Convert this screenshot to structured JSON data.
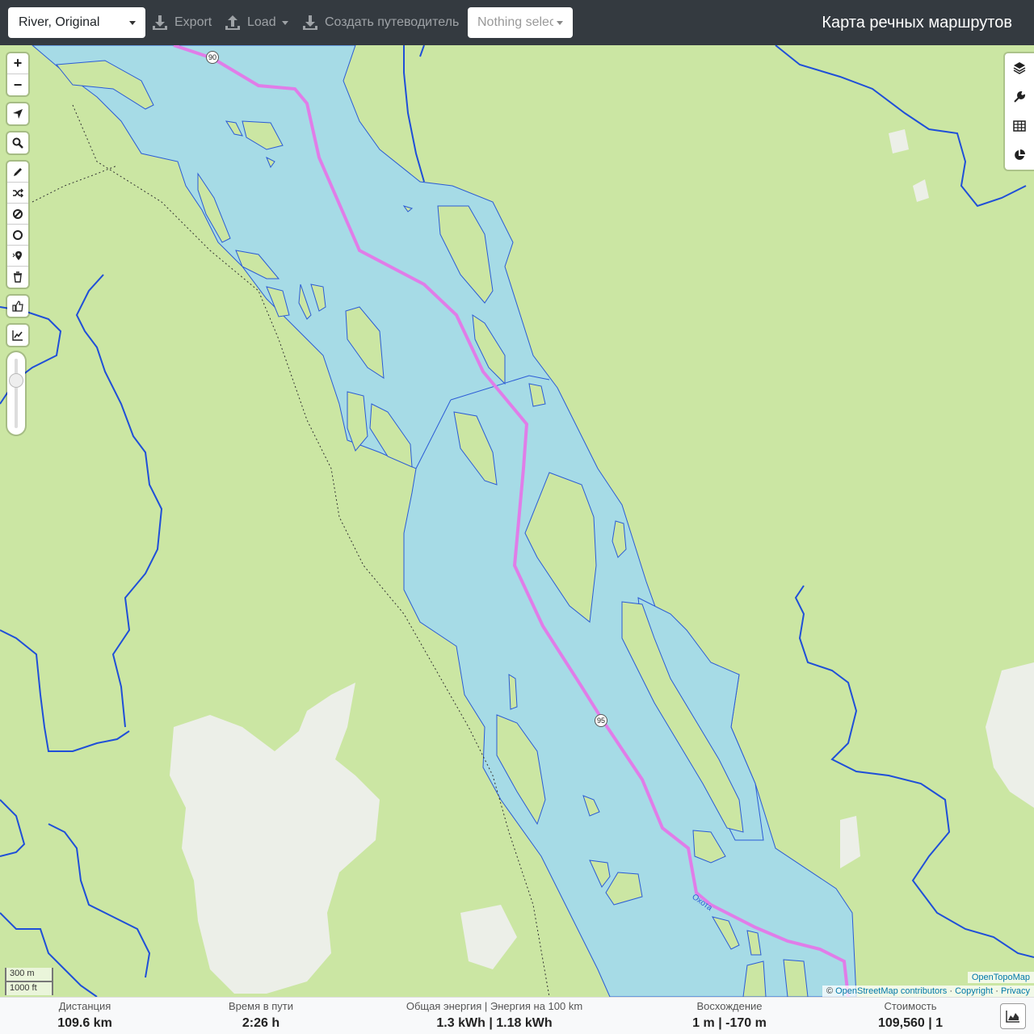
{
  "header": {
    "profile": "River, Original",
    "export_label": "Export",
    "load_label": "Load",
    "guide_label": "Создать путеводитель",
    "nothing_selected": "Nothing selected",
    "title": "Карта речных маршрутов"
  },
  "map": {
    "route_markers": [
      "90",
      "95"
    ],
    "river_label": "Охота",
    "scale": {
      "metric": "300 m",
      "imperial": "1000 ft"
    },
    "attribution": {
      "tiles": "OpenTopoMap",
      "osm": "OpenStreetMap contributors",
      "copyright": "Copyright",
      "privacy": "Privacy"
    },
    "left_controls": [
      "zoom-in",
      "zoom-out",
      "locate",
      "search",
      "draw-route",
      "shuffle",
      "no-go-area",
      "circle",
      "poi",
      "delete",
      "thumbs-up",
      "elevation-chart"
    ],
    "right_controls": [
      "layers",
      "tools",
      "table",
      "analysis"
    ]
  },
  "stats": {
    "distance_label": "Дистанция",
    "distance_value": "109.6 km",
    "time_label": "Время в пути",
    "time_value": "2:26 h",
    "energy_label": "Общая энергия | Энергия на 100 km",
    "energy_value": "1.3 kWh | 1.18 kWh",
    "ascent_label": "Восхождение",
    "ascent_value": "1 m | -170 m",
    "cost_label": "Стоимость",
    "cost_value": "109,560 | 1"
  }
}
